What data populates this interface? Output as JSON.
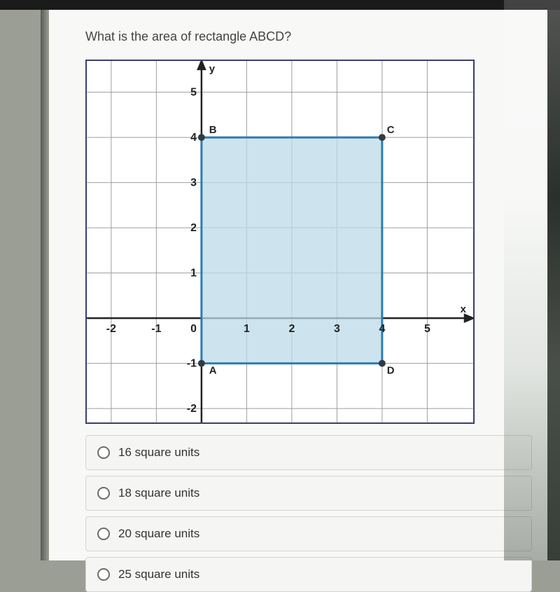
{
  "question": "What is the area of rectangle ABCD?",
  "chart_data": {
    "type": "scatter",
    "title": "",
    "xlabel": "x",
    "ylabel": "y",
    "xlim": [
      -2,
      6
    ],
    "ylim": [
      -2,
      6
    ],
    "x_ticks": [
      -2,
      -1,
      0,
      1,
      2,
      3,
      4,
      5
    ],
    "y_ticks": [
      -2,
      -1,
      0,
      1,
      2,
      3,
      4,
      5
    ],
    "rectangle": {
      "A": {
        "x": 0,
        "y": -1,
        "label": "A"
      },
      "B": {
        "x": 0,
        "y": 4,
        "label": "B"
      },
      "C": {
        "x": 4,
        "y": 4,
        "label": "C"
      },
      "D": {
        "x": 4,
        "y": -1,
        "label": "D"
      }
    },
    "grid": true
  },
  "options": [
    {
      "label": "16 square units"
    },
    {
      "label": "18 square units"
    },
    {
      "label": "20 square units"
    },
    {
      "label": "25 square units"
    }
  ]
}
